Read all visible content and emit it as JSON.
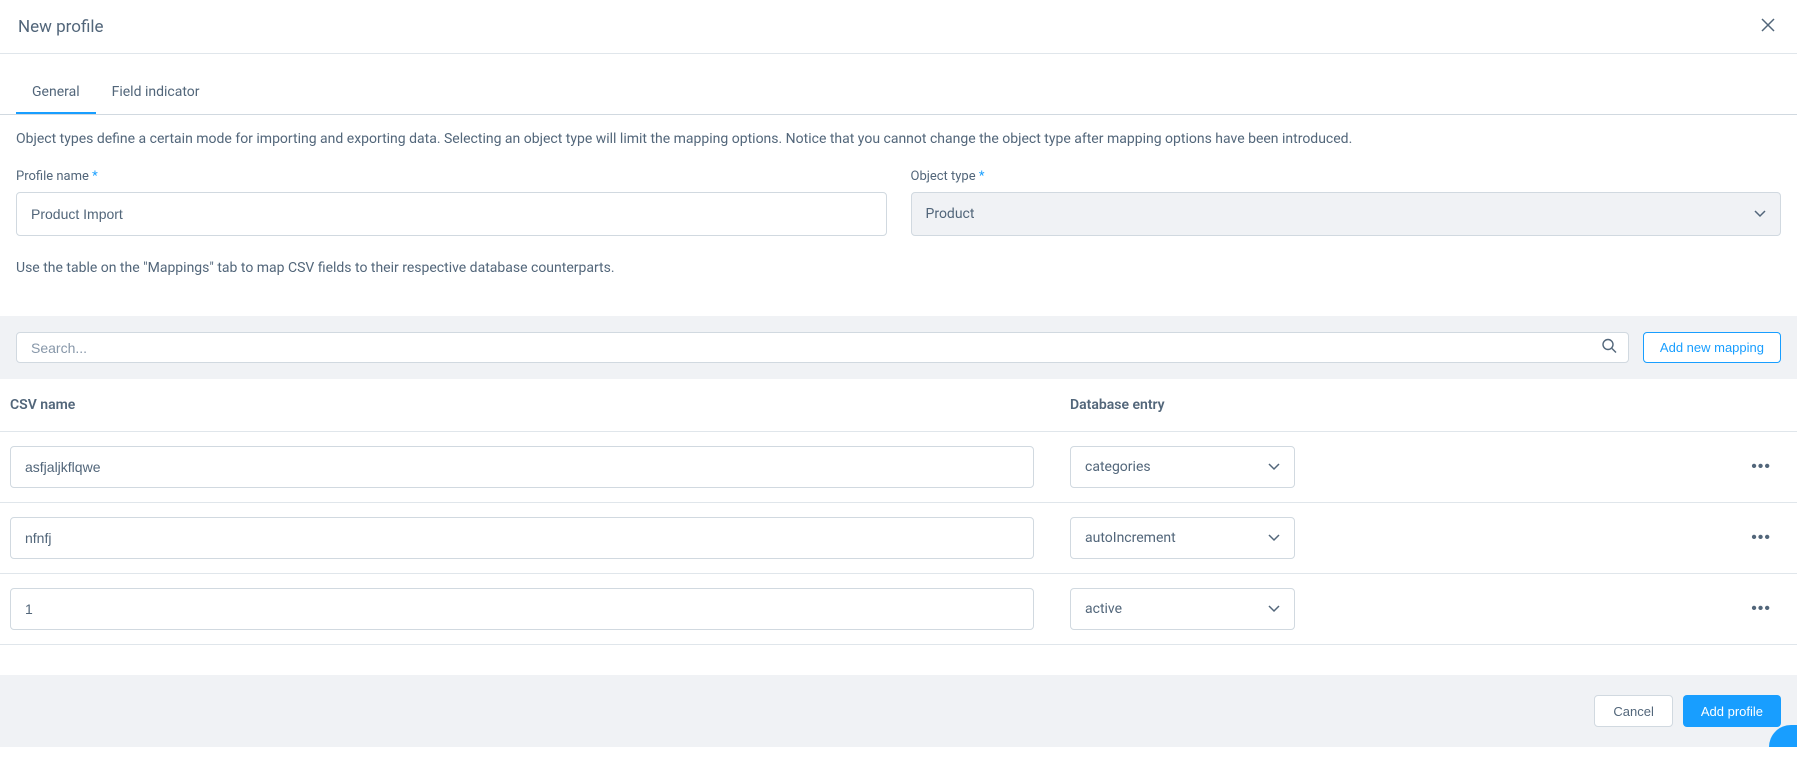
{
  "modal": {
    "title": "New profile"
  },
  "tabs": {
    "general": "General",
    "field_indicator": "Field indicator"
  },
  "text": {
    "object_type_help": "Object types define a certain mode for importing and exporting data. Selecting an object type will limit the mapping options. Notice that you cannot change the object type after mapping options have been introduced.",
    "mappings_help": "Use the table on the \"Mappings\" tab to map CSV fields to their respective database counterparts."
  },
  "form": {
    "profile_name_label": "Profile name",
    "profile_name_value": "Product Import",
    "object_type_label": "Object type",
    "object_type_value": "Product"
  },
  "search": {
    "placeholder": "Search..."
  },
  "buttons": {
    "add_mapping": "Add new mapping",
    "cancel": "Cancel",
    "add_profile": "Add profile"
  },
  "columns": {
    "csv_name": "CSV name",
    "db_entry": "Database entry"
  },
  "rows": [
    {
      "csv": "asfjaljkflqwe",
      "db": "categories"
    },
    {
      "csv": "nfnfj",
      "db": "autoIncrement"
    },
    {
      "csv": "1",
      "db": "active"
    }
  ]
}
